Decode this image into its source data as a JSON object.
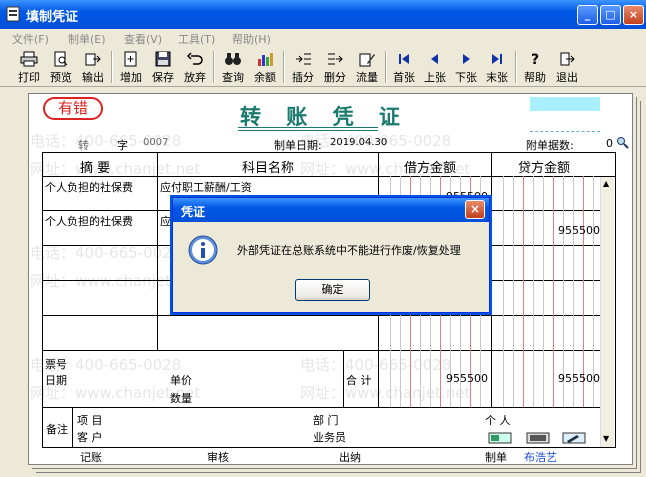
{
  "window": {
    "title": "填制凭证",
    "min": "_",
    "max": "□",
    "close": "×"
  },
  "menu": [
    "文件(F)",
    "制单(E)",
    "查看(V)",
    "工具(T)",
    "帮助(H)"
  ],
  "toolbar": [
    "打印",
    "预览",
    "输出",
    "增加",
    "保存",
    "放弃",
    "查询",
    "余额",
    "插分",
    "删分",
    "流量",
    "首张",
    "上张",
    "下张",
    "末张",
    "帮助",
    "退出"
  ],
  "voucher": {
    "status": "有错",
    "title": "转 账 凭 证",
    "type_char": "转",
    "zi": "字",
    "number": "0007",
    "date_label": "制单日期:",
    "date": "2019.04.30",
    "attach_label": "附单据数:",
    "attach_count": "0"
  },
  "table": {
    "headers": {
      "summary": "摘 要",
      "account": "科目名称",
      "debit": "借方金额",
      "credit": "贷方金额"
    },
    "rows": [
      {
        "summary": "个人负担的社保费",
        "account": "应付职工薪酬/工资",
        "debit": "955500",
        "credit": ""
      },
      {
        "summary": "个人负担的社保费",
        "account": "应",
        "debit": "",
        "credit": "955500"
      }
    ],
    "footer": {
      "ticket_no": "票号",
      "date": "日期",
      "unit_price": "单价",
      "quantity": "数量",
      "total": "合 计",
      "total_debit": "955500",
      "total_credit": "955500"
    },
    "notes": {
      "label": "备注",
      "project": "项  目",
      "customer": "客  户",
      "department": "部  门",
      "person": "个  人",
      "salesman": "业务员"
    }
  },
  "signoff": {
    "bookkeeping": "记账",
    "audit": "审核",
    "cashier": "出纳",
    "maker_label": "制单",
    "maker": "布浩艺"
  },
  "dialog": {
    "title": "凭证",
    "message": "外部凭证在总账系统中不能进行作废/恢复处理",
    "ok": "确定",
    "close": "×"
  },
  "watermark": {
    "phone": "电话：400-665-0028",
    "url": "网址：www.chanjet.net"
  },
  "colors": {
    "title_teal": "#1a7a6e",
    "stamp_red": "#dd2222",
    "titlebar_blue": "#0058e6"
  }
}
